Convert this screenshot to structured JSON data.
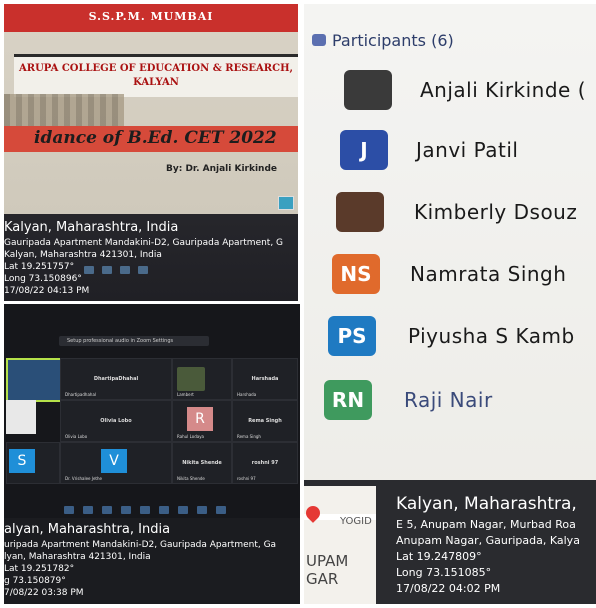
{
  "top_left": {
    "slide": {
      "org": "S.S.P.M. MUMBAI",
      "college_line1": "ARUPA COLLEGE OF EDUCATION & RESEARCH,",
      "college_line2": "KALYAN",
      "title": "idance of B.Ed. CET 2022",
      "by": "By: Dr. Anjali Kirkinde"
    },
    "geo": {
      "city": "Kalyan, Maharashtra, India",
      "address1": "Gauripada Apartment Mandakini-D2, Gauripada Apartment, G",
      "address2": "Kalyan, Maharashtra 421301, India",
      "lat": "Lat 19.251757°",
      "long": "Long 73.150896°",
      "datetime": "17/08/22 04:13 PM"
    }
  },
  "bottom_left": {
    "zoom_banner": "Setup professional audio in Zoom Settings",
    "tiles": {
      "t1": "DhartipaDhahal",
      "t2": "Harshada",
      "t3": "Olivia Lobo",
      "t4": "Rema Singh",
      "t5": "Nikita Shende",
      "t6": "roshni 97",
      "name_t1": "Dhartipadhahal",
      "name_t2": "Lambert",
      "name_t3": "Harshada",
      "name_t4": "Olivia Lobo",
      "name_t5": "Rahul Lodaya",
      "name_t6": "Rema Singh",
      "name_t7": "Dr. Vrishalee Jethe",
      "name_t8": "Nikita Shende",
      "name_t9": "roshni 97",
      "avatar_s": "S",
      "avatar_v": "V",
      "avatar_r": "R"
    },
    "geo": {
      "city": "alyan, Maharashtra, India",
      "address1": "uripada Apartment Mandakini-D2, Gauripada Apartment, Ga",
      "address2": "lyan, Maharashtra 421301, India",
      "lat": "Lat 19.251782°",
      "long": "g 73.150879°",
      "datetime": "7/08/22 03:38 PM"
    }
  },
  "right": {
    "header": "Participants (6)",
    "participants": [
      {
        "initials": "",
        "name": "Anjali Kirkinde (",
        "avatar_color": "#3a3a3a"
      },
      {
        "initials": "J",
        "name": "Janvi Patil",
        "avatar_color": "#2c4ea6"
      },
      {
        "initials": "",
        "name": "Kimberly Dsouz",
        "avatar_color": "#5a3a2a"
      },
      {
        "initials": "NS",
        "name": "Namrata Singh",
        "avatar_color": "#e06a2c"
      },
      {
        "initials": "PS",
        "name": "Piyusha S Kamb",
        "avatar_color": "#1f7ac2"
      },
      {
        "initials": "RN",
        "name": "Raji Nair",
        "avatar_color": "#3f9a5e"
      }
    ],
    "map": {
      "poi": "YOGID",
      "area_line1": "UPAM",
      "area_line2": "GAR"
    },
    "geo": {
      "city": "Kalyan, Maharashtra,",
      "address1": "E 5, Anupam Nagar, Murbad Roa",
      "address2": "Anupam Nagar, Gauripada, Kalya",
      "lat": "Lat 19.247809°",
      "long": "Long 73.151085°",
      "datetime": "17/08/22 04:02 PM"
    }
  }
}
